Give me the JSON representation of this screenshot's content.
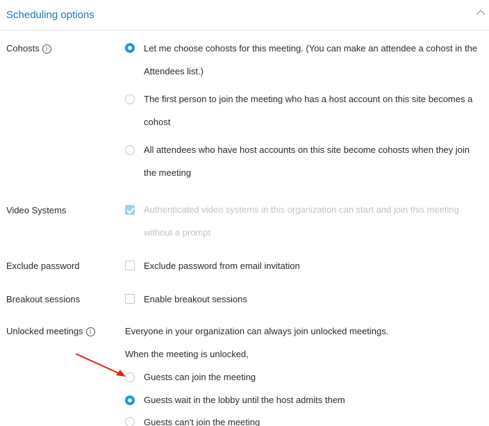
{
  "header": {
    "title": "Scheduling options",
    "collapse_icon": "chevron-up-icon"
  },
  "cohosts": {
    "label": "Cohosts",
    "options": [
      {
        "line1": "Let me choose cohosts for this meeting. (You can make an attendee a cohost in the",
        "line2": "Attendees list.)",
        "checked": true
      },
      {
        "line1": "The first person to join the meeting who has a host account on this site becomes a",
        "line2": "cohost",
        "checked": false
      },
      {
        "line1": "All attendees who have host accounts on this site become cohosts when they join",
        "line2": "the meeting",
        "checked": false
      }
    ]
  },
  "video_systems": {
    "label": "Video Systems",
    "line1": "Authenticated video systems in this organization can start and join this meeting",
    "line2": "without a prompt",
    "checked": true,
    "disabled": true
  },
  "exclude_password": {
    "label": "Exclude password",
    "text": "Exclude password from email invitation",
    "checked": false
  },
  "breakout_sessions": {
    "label": "Breakout sessions",
    "text": "Enable breakout sessions",
    "checked": false
  },
  "unlocked_meetings": {
    "label": "Unlocked meetings",
    "description": "Everyone in your organization can always join unlocked meetings.",
    "subheading": "When the meeting is unlocked,",
    "options": [
      {
        "text": "Guests can join the meeting",
        "checked": false
      },
      {
        "text": "Guests wait in the lobby until the host admits them",
        "checked": true
      },
      {
        "text": "Guests can't join the meeting",
        "checked": false
      }
    ]
  },
  "colors": {
    "accent": "#1a9ad6",
    "title": "#1a76b5",
    "annotation_arrow": "#e0211b"
  }
}
